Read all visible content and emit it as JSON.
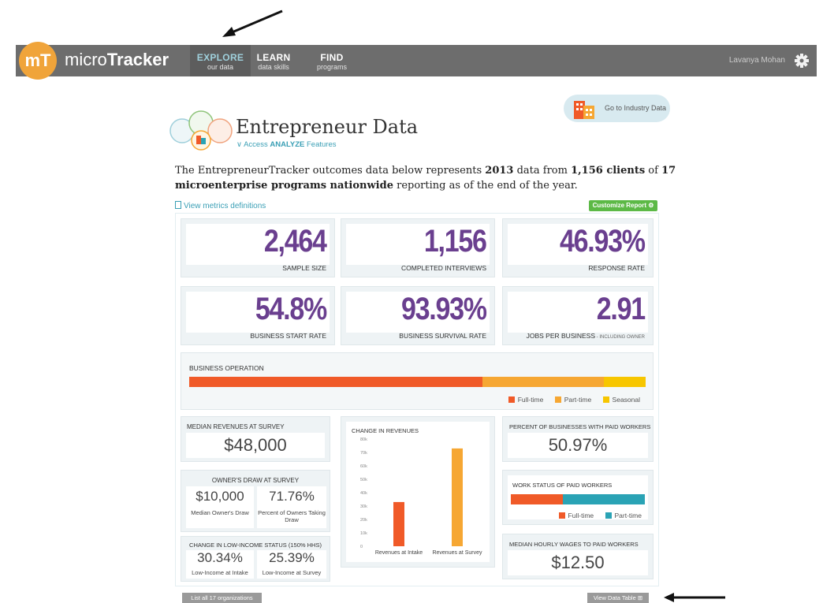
{
  "nav": {
    "logo_mark": "mT",
    "logo_brand_light": "micro",
    "logo_brand_bold": "Tracker",
    "items": [
      {
        "title": "EXPLORE",
        "subtitle": "our data"
      },
      {
        "title": "LEARN",
        "subtitle": "data skills"
      },
      {
        "title": "FIND",
        "subtitle": "programs"
      }
    ],
    "user_name": "Lavanya Mohan",
    "settings_icon": "gear-icon"
  },
  "header": {
    "industry_button": "Go to Industry Data",
    "title": "Entrepreneur Data",
    "analyze_prefix": "Access ",
    "analyze_bold": "ANALYZE",
    "analyze_suffix": " Features"
  },
  "intro": {
    "p1": "The EntrepreneurTracker outcomes data below represents ",
    "b1": "2013",
    "p2": " data from ",
    "b2": "1,156 clients",
    "p3": " of ",
    "b3": "17 microenterprise programs nationwide",
    "p4": " reporting as of the end of the year."
  },
  "links": {
    "metrics": "View metrics definitions",
    "customize": "Customize Report"
  },
  "kpis": [
    {
      "value": "2,464",
      "label": "SAMPLE SIZE"
    },
    {
      "value": "1,156",
      "label": "COMPLETED INTERVIEWS"
    },
    {
      "value": "46.93%",
      "label": "RESPONSE RATE"
    },
    {
      "value": "54.8%",
      "label": "BUSINESS START RATE"
    },
    {
      "value": "93.93%",
      "label": "BUSINESS SURVIVAL RATE"
    },
    {
      "value": "2.91",
      "label": "JOBS PER BUSINESS",
      "note": " - INCLUDING OWNER"
    }
  ],
  "business_operation": {
    "title": "BUSINESS OPERATION",
    "segments": [
      {
        "name": "Full-time",
        "share": 0.643,
        "color": "#f05a28"
      },
      {
        "name": "Part-time",
        "share": 0.266,
        "color": "#f6a733"
      },
      {
        "name": "Seasonal",
        "share": 0.091,
        "color": "#f7c600"
      }
    ]
  },
  "median_revenues": {
    "title": "MEDIAN REVENUES AT SURVEY",
    "value": "$48,000"
  },
  "owners_draw": {
    "title": "OWNER'S DRAW AT SURVEY",
    "left_value": "$10,000",
    "left_label": "Median Owner's Draw",
    "right_value": "71.76%",
    "right_label": "Percent of Owners Taking Draw"
  },
  "low_income": {
    "title": "CHANGE IN LOW-INCOME STATUS (150% HHS)",
    "left_value": "30.34%",
    "left_label": "Low-Income at Intake",
    "right_value": "25.39%",
    "right_label": "Low-Income at Survey"
  },
  "paid_workers": {
    "title": "PERCENT OF BUSINESSES WITH PAID WORKERS",
    "value": "50.97%"
  },
  "work_status": {
    "title": "WORK STATUS OF PAID WORKERS",
    "segments": [
      {
        "name": "Full-time",
        "share": 0.39,
        "color": "#f05a28"
      },
      {
        "name": "Part-time",
        "share": 0.61,
        "color": "#2aa3b5"
      }
    ]
  },
  "hourly_wages": {
    "title": "MEDIAN HOURLY WAGES TO PAID WORKERS",
    "value": "$12.50"
  },
  "chart_data": {
    "type": "bar",
    "title": "CHANGE IN REVENUES",
    "categories": [
      "Revenues at Intake",
      "Revenues at Survey"
    ],
    "values": [
      33000,
      73000
    ],
    "colors": [
      "#f05a28",
      "#f6a733"
    ],
    "ylim": [
      0,
      80000
    ],
    "yticks": [
      0,
      10000,
      20000,
      30000,
      40000,
      50000,
      60000,
      70000,
      80000
    ],
    "ytick_labels": [
      "0",
      "10k",
      "20k",
      "30k",
      "40k",
      "50k",
      "60k",
      "70k",
      "80k"
    ],
    "grid": false
  },
  "footer": {
    "list_orgs": "List all 17 organizations",
    "view_table": "View Data Table"
  }
}
